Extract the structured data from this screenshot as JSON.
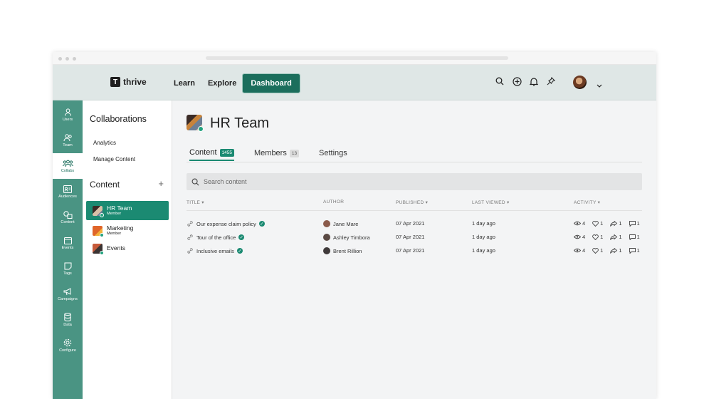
{
  "brand": {
    "name": "thrive",
    "mark": "T"
  },
  "nav": [
    "Learn",
    "Explore",
    "Dashboard"
  ],
  "rail": [
    {
      "label": "Users",
      "icon": "user-icon"
    },
    {
      "label": "Team",
      "icon": "team-icon"
    },
    {
      "label": "Collabs",
      "icon": "collabs-icon",
      "active": true
    },
    {
      "label": "Audiences",
      "icon": "audiences-icon"
    },
    {
      "label": "Content",
      "icon": "content-icon"
    },
    {
      "label": "Events",
      "icon": "events-icon"
    },
    {
      "label": "Tags",
      "icon": "tags-icon"
    },
    {
      "label": "Campaigns",
      "icon": "megaphone-icon"
    },
    {
      "label": "Data",
      "icon": "database-icon"
    },
    {
      "label": "Configure",
      "icon": "gear-icon"
    }
  ],
  "panel": {
    "title": "Collaborations",
    "links": [
      "Analytics",
      "Manage Content"
    ],
    "content_heading": "Content",
    "add": "+",
    "teams": [
      {
        "name": "HR Team",
        "role": "Member",
        "active": true
      },
      {
        "name": "Marketing",
        "role": "Member"
      },
      {
        "name": "Events",
        "role": ""
      }
    ]
  },
  "page": {
    "title": "HR Team",
    "tabs": [
      {
        "label": "Content",
        "count": "1455",
        "active": true
      },
      {
        "label": "Members",
        "count": "13"
      },
      {
        "label": "Settings",
        "count": ""
      }
    ],
    "search_placeholder": "Search content"
  },
  "table": {
    "headers": [
      "TITLE",
      "AUTHOR",
      "PUBLISHED",
      "LAST VIEWED",
      "ACTIVITY"
    ],
    "rows": [
      {
        "title": "Our expense claim policy",
        "author": "Jane Mare",
        "published": "07 Apr 2021",
        "viewed": "1 day ago",
        "views": "4",
        "likes": "1",
        "shares": "1",
        "comments": "1"
      },
      {
        "title": "Tour of the office",
        "author": "Ashley Timbora",
        "published": "07 Apr 2021",
        "viewed": "1 day ago",
        "views": "4",
        "likes": "1",
        "shares": "1",
        "comments": "1"
      },
      {
        "title": "Inclusive emails",
        "author": "Brent Rillion",
        "published": "07 Apr 2021",
        "viewed": "1 day ago",
        "views": "4",
        "likes": "1",
        "shares": "1",
        "comments": "1"
      }
    ]
  },
  "colors": {
    "accent": "#1b8a72",
    "rail": "#4a9483",
    "topbar": "#dfe7e6"
  }
}
